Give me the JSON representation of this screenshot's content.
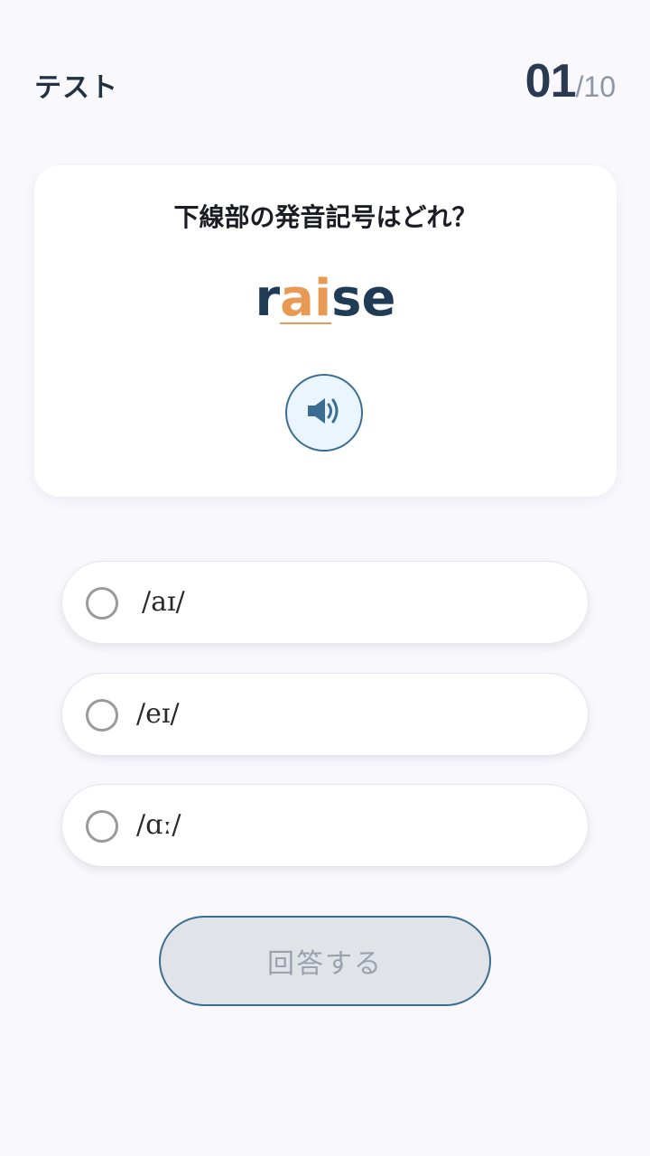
{
  "header": {
    "title": "テスト",
    "current": "01",
    "total": "/10"
  },
  "question": {
    "prompt": "下線部の発音記号はどれ？",
    "word_before": "r",
    "word_highlight": "ai",
    "word_after": "se",
    "audio_icon": "speaker-icon"
  },
  "options": [
    {
      "label": "/aɪ/"
    },
    {
      "label": "/eɪ/"
    },
    {
      "label": "/ɑː/"
    }
  ],
  "submit": {
    "label": "回答する"
  },
  "colors": {
    "background": "#f8f8fd",
    "accent": "#3b6d92",
    "highlight": "#e89a55",
    "disabled_button": "#e0e3e8"
  }
}
